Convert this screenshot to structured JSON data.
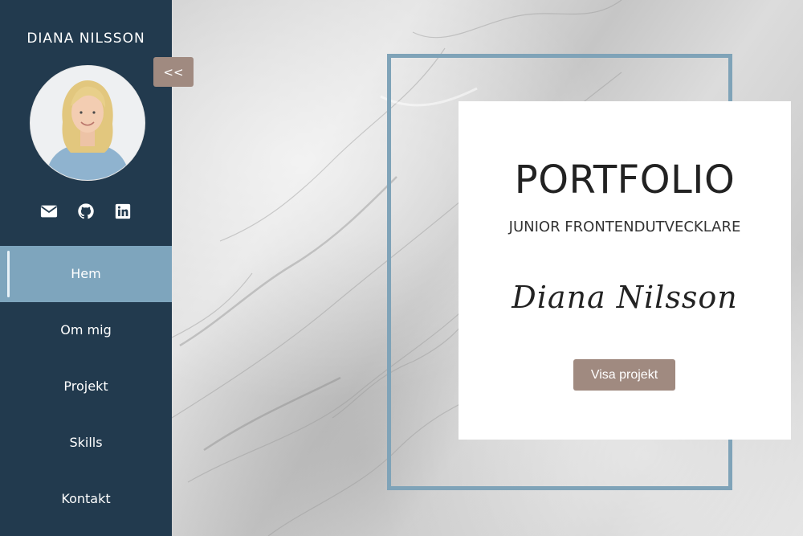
{
  "sidebar": {
    "name": "DIANA NILSSON",
    "collapse_label": "<<",
    "social": [
      {
        "icon": "mail-icon"
      },
      {
        "icon": "github-icon"
      },
      {
        "icon": "linkedin-icon"
      }
    ],
    "nav": [
      {
        "label": "Hem",
        "active": true
      },
      {
        "label": "Om mig"
      },
      {
        "label": "Projekt"
      },
      {
        "label": "Skills"
      },
      {
        "label": "Kontakt"
      }
    ]
  },
  "hero": {
    "title": "PORTFOLIO",
    "subtitle": "JUNIOR FRONTENDUTVECKLARE",
    "signature": "Diana Nilsson",
    "cta_label": "Visa projekt"
  },
  "colors": {
    "sidebar_bg": "#223a4e",
    "nav_active_bg": "#7ea5bd",
    "accent_button": "#a08a80",
    "frame": "#7fa3b8"
  }
}
